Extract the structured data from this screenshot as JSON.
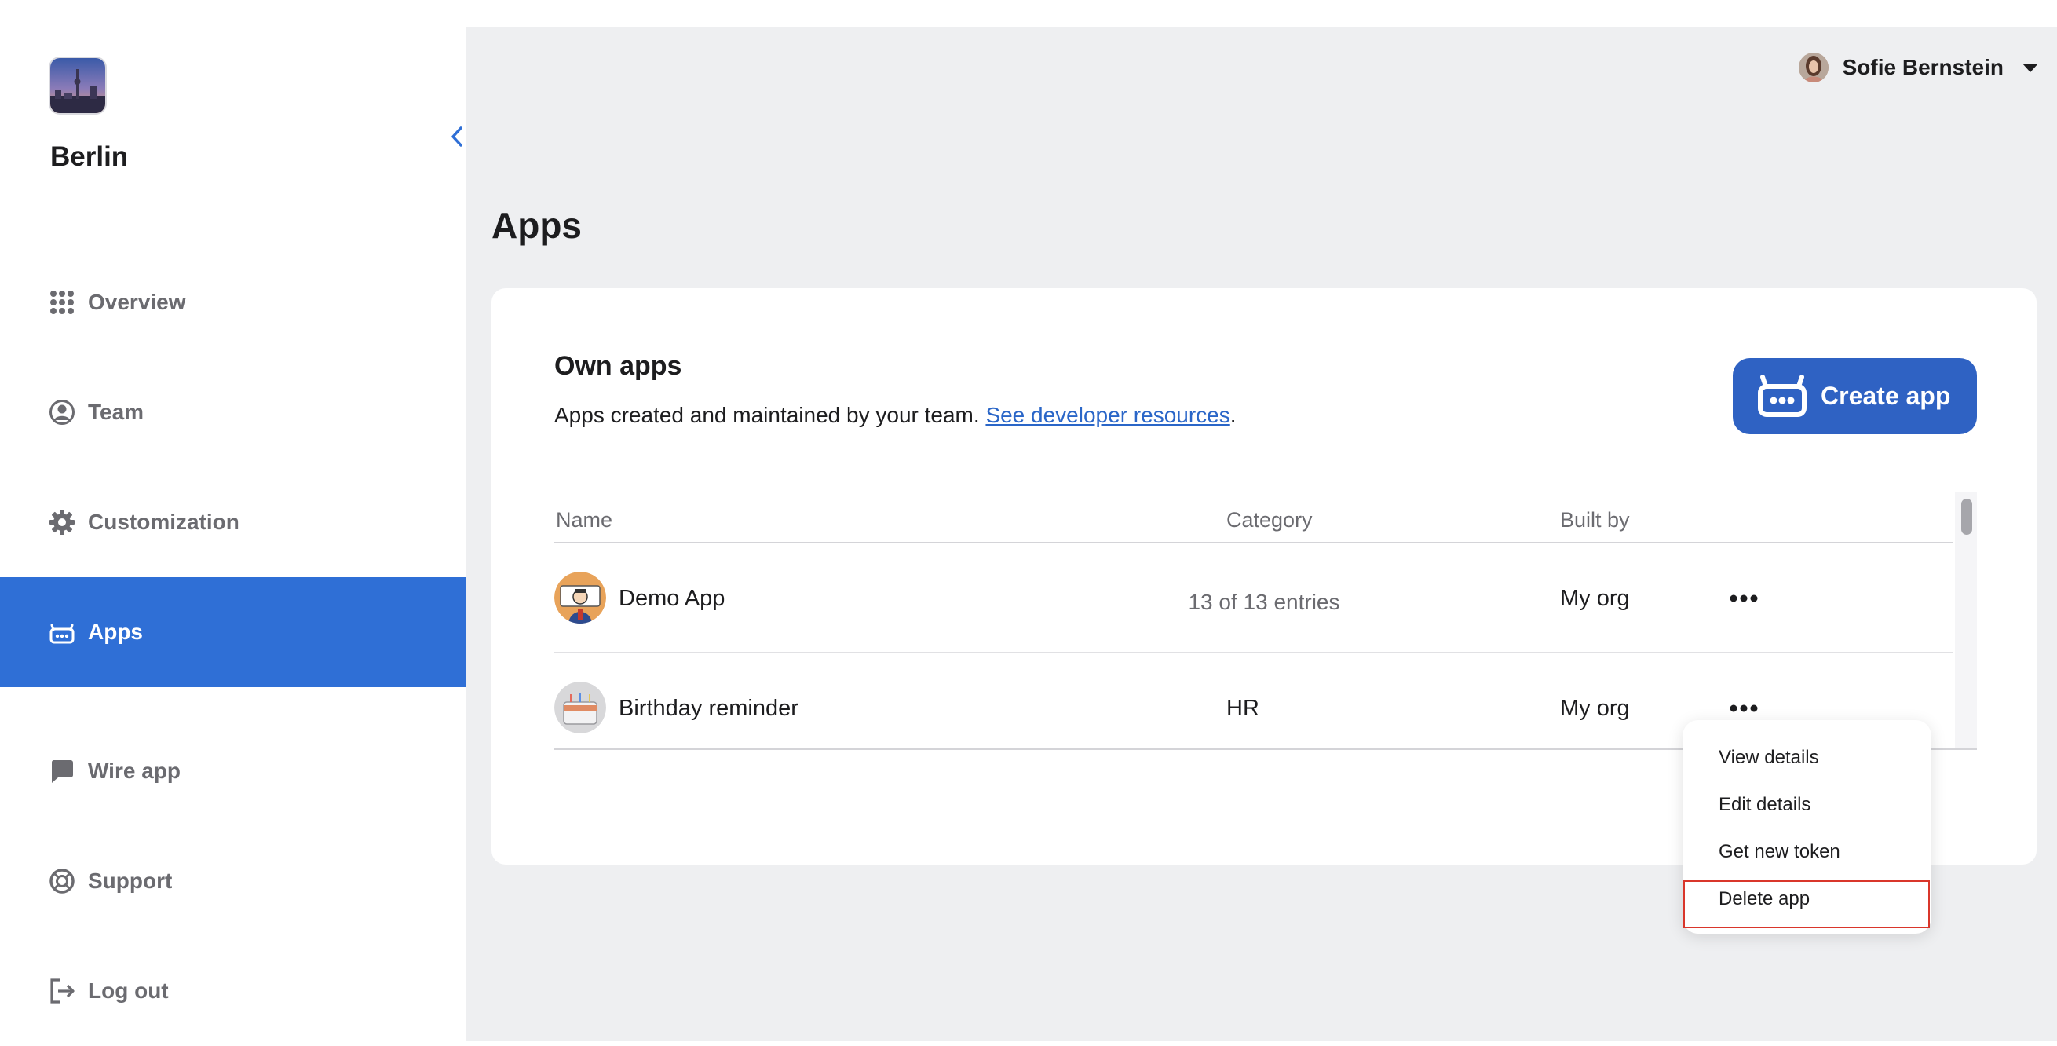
{
  "sidebar": {
    "team_name": "Berlin",
    "items": [
      {
        "label": "Overview",
        "icon": "grid-icon"
      },
      {
        "label": "Team",
        "icon": "user-circle-icon"
      },
      {
        "label": "Customization",
        "icon": "gear-icon"
      },
      {
        "label": "Apps",
        "icon": "robot-icon",
        "active": true
      },
      {
        "label": "Wire app",
        "icon": "chat-bubble-icon"
      },
      {
        "label": "Support",
        "icon": "lifebuoy-icon"
      },
      {
        "label": "Log out",
        "icon": "logout-icon"
      }
    ],
    "active_color": "#2f6fd6"
  },
  "header": {
    "user_name": "Sofie Bernstein"
  },
  "main": {
    "page_title": "Apps",
    "card": {
      "title": "Own apps",
      "subtitle": "Apps created and maintained by your team.",
      "link_text": "See developer resources",
      "period": ".",
      "create_button": "Create app"
    },
    "table": {
      "columns": [
        "Name",
        "Category",
        "Built by"
      ],
      "rows": [
        {
          "name": "Demo App",
          "category": "",
          "built_by": "My org"
        },
        {
          "name": "Birthday reminder",
          "category": "HR",
          "built_by": "My org"
        }
      ],
      "entries_text": "13 of 13 entries"
    }
  },
  "dropdown": {
    "items": [
      "View details",
      "Edit details",
      "Get new token",
      "Delete app"
    ]
  },
  "colors": {
    "primary_button": "#2f62c3",
    "link": "#2a66c8",
    "highlight_border": "#d9362b"
  }
}
